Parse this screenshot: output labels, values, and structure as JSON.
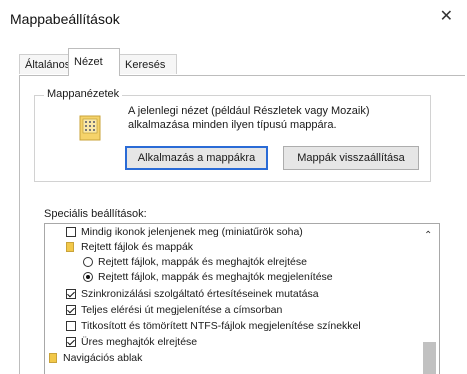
{
  "window": {
    "title": "Mappabeállítások",
    "close_glyph": "✕"
  },
  "tabs": [
    {
      "label": "Általános"
    },
    {
      "label": "Nézet"
    },
    {
      "label": "Keresés"
    }
  ],
  "folder_views": {
    "title": "Mappanézetek",
    "description": "A jelenlegi nézet (például Részletek vagy Mozaik) alkalmazása minden ilyen típusú mappára.",
    "apply_button": "Alkalmazás a mappákra",
    "reset_button": "Mappák visszaállítása"
  },
  "advanced": {
    "label": "Speciális beállítások:",
    "items": [
      {
        "type": "checkbox",
        "checked": false,
        "label": "Mindig ikonok jelenjenek meg (miniatűrök soha)"
      },
      {
        "type": "folder",
        "label": "Rejtett fájlok és mappák"
      },
      {
        "type": "radio",
        "selected": false,
        "label": "Rejtett fájlok, mappák és meghajtók elrejtése"
      },
      {
        "type": "radio",
        "selected": true,
        "label": "Rejtett fájlok, mappák és meghajtók megjelenítése"
      },
      {
        "type": "checkbox",
        "checked": true,
        "label": "Szinkronizálási szolgáltató értesítéseinek mutatása"
      },
      {
        "type": "checkbox",
        "checked": true,
        "label": "Teljes elérési út megjelenítése a címsorban"
      },
      {
        "type": "checkbox",
        "checked": false,
        "label": "Titkosított és tömörített NTFS-fájlok megjelenítése színekkel"
      },
      {
        "type": "checkbox",
        "checked": true,
        "label": "Üres meghajtók elrejtése"
      },
      {
        "type": "folder",
        "label": "Navigációs ablak"
      }
    ]
  },
  "icons": {
    "folder": "folder-icon",
    "scroll_up": "scroll-up-arrow-icon"
  },
  "colors": {
    "focus_border": "#2a6bd6",
    "folder_yellow": "#f2c849"
  }
}
